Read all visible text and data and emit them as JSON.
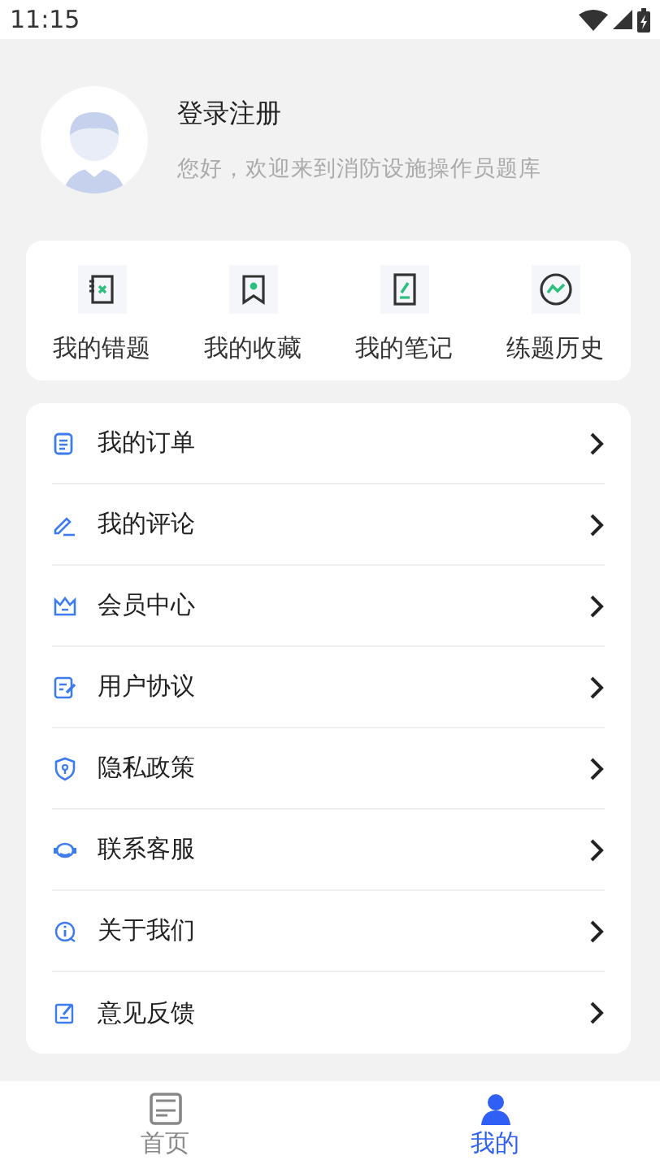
{
  "status_bar": {
    "time": "11:15"
  },
  "profile": {
    "title": "登录注册",
    "subtitle": "您好，欢迎来到消防设施操作员题库"
  },
  "shortcuts": [
    {
      "label": "我的错题"
    },
    {
      "label": "我的收藏"
    },
    {
      "label": "我的笔记"
    },
    {
      "label": "练题历史"
    }
  ],
  "menu": [
    {
      "label": "我的订单"
    },
    {
      "label": "我的评论"
    },
    {
      "label": "会员中心"
    },
    {
      "label": "用户协议"
    },
    {
      "label": "隐私政策"
    },
    {
      "label": "联系客服"
    },
    {
      "label": "关于我们"
    },
    {
      "label": "意见反馈"
    }
  ],
  "tabs": [
    {
      "label": "首页",
      "selected": false
    },
    {
      "label": "我的",
      "selected": true
    }
  ]
}
